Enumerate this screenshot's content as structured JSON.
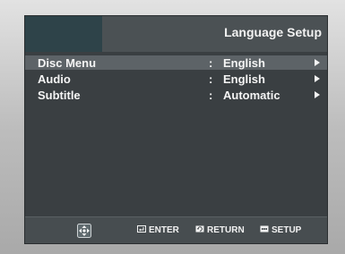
{
  "header": {
    "title": "Language Setup"
  },
  "menu": {
    "items": [
      {
        "label": "Disc Menu",
        "separator": ":",
        "value": "English",
        "arrow_icon": "right-triangle-icon",
        "selected": true
      },
      {
        "label": "Audio",
        "separator": ":",
        "value": "English",
        "arrow_icon": "right-triangle-icon",
        "selected": false
      },
      {
        "label": "Subtitle",
        "separator": ":",
        "value": "Automatic",
        "arrow_icon": "right-triangle-icon",
        "selected": false
      }
    ]
  },
  "footer": {
    "nav_icon": "directional-pad-icon",
    "enter_icon": "enter-icon",
    "enter_label": "ENTER",
    "return_icon": "return-icon",
    "return_label": "RETURN",
    "setup_icon": "setup-icon",
    "setup_label": "SETUP"
  },
  "colors": {
    "screen_background": "#3a3f42",
    "header_left": "#2e4349",
    "header_right": "#4b5154",
    "selected_row": "#5d6367",
    "text": "#f4f4f4"
  }
}
